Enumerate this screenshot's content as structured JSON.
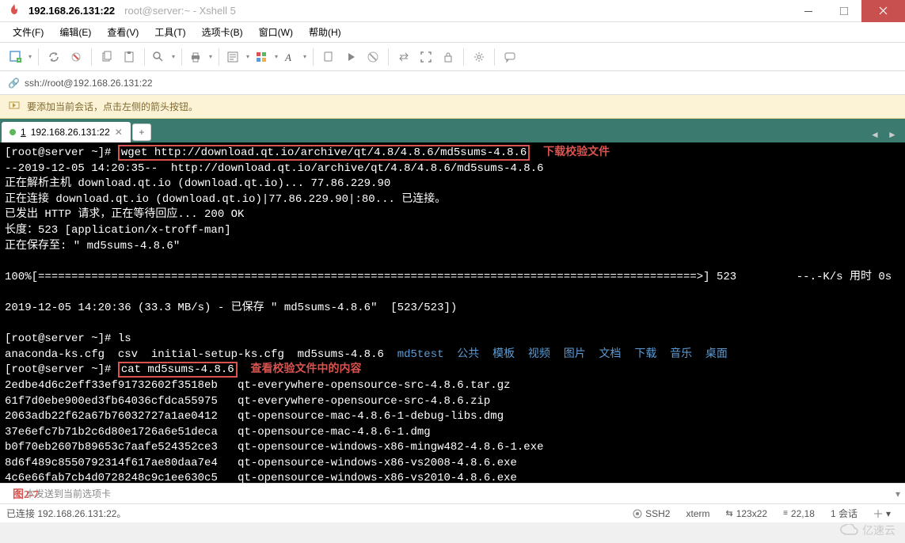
{
  "title": {
    "address": "192.168.26.131:22",
    "subtitle": "root@server:~ - Xshell 5"
  },
  "menu": {
    "file": "文件(F)",
    "edit": "编辑(E)",
    "view": "查看(V)",
    "tools": "工具(T)",
    "tabs": "选项卡(B)",
    "window": "窗口(W)",
    "help": "帮助(H)"
  },
  "urlbar": {
    "text": "ssh://root@192.168.26.131:22"
  },
  "hint": {
    "text": "要添加当前会话，点击左侧的箭头按钮。"
  },
  "tab": {
    "index": "1",
    "label": "192.168.26.131:22"
  },
  "terminal": {
    "prompt1": "[root@server ~]# ",
    "cmd1": "wget http://download.qt.io/archive/qt/4.8/4.8.6/md5sums-4.8.6",
    "anno1": "下载校验文件",
    "line2": "--2019-12-05 14:20:35--  http://download.qt.io/archive/qt/4.8/4.8.6/md5sums-4.8.6",
    "line3": "正在解析主机 download.qt.io (download.qt.io)... 77.86.229.90",
    "line4": "正在连接 download.qt.io (download.qt.io)|77.86.229.90|:80... 已连接。",
    "line5": "已发出 HTTP 请求，正在等待回应... 200 OK",
    "line6": "长度：523 [application/x-troff-man]",
    "line7": "正在保存至: \" md5sums-4.8.6\"",
    "line8": "100%[===================================================================================================>] 523         --.-K/s 用时 0s",
    "line9": "2019-12-05 14:20:36 (33.3 MB/s) - 已保存 \" md5sums-4.8.6\"  [523/523])",
    "prompt_ls": "[root@server ~]# ls",
    "ls_plain": "anaconda-ks.cfg  csv  initial-setup-ks.cfg  md5sums-4.8.6  ",
    "ls_blue": "md5test  公共  模板  视频  图片  文档  下载  音乐  桌面",
    "prompt3": "[root@server ~]# ",
    "cmd3": "cat md5sums-4.8.6",
    "anno3": "查看校验文件中的内容",
    "md5_1": "2edbe4d6c2eff33ef91732602f3518eb   qt-everywhere-opensource-src-4.8.6.tar.gz",
    "md5_2": "61f7d0ebe900ed3fb64036cfdca55975   qt-everywhere-opensource-src-4.8.6.zip",
    "md5_3": "2063adb22f62a67b76032727a1ae0412   qt-opensource-mac-4.8.6-1-debug-libs.dmg",
    "md5_4": "37e6efc7b71b2c6d80e1726a6e51deca   qt-opensource-mac-4.8.6-1.dmg",
    "md5_5": "b0f70eb2607b89653c7aafe524352ce3   qt-opensource-windows-x86-mingw482-4.8.6-1.exe",
    "md5_6": "8d6f489c8550792314f617ae80daa7e4   qt-opensource-windows-x86-vs2008-4.8.6.exe",
    "md5_7": "4c6e66fab7cb4d0728248c9c1ee630c5   qt-opensource-windows-x86-vs2010-4.8.6.exe"
  },
  "sendbar": {
    "placeholder": "    本发送到当前选项卡",
    "figlabel": "图2-7"
  },
  "status": {
    "left": "已连接 192.168.26.131:22。",
    "ssh": "SSH2",
    "term": "xterm",
    "size": "123x22",
    "pos": "22,18",
    "sessions": "1 会话"
  },
  "watermark": "亿速云"
}
